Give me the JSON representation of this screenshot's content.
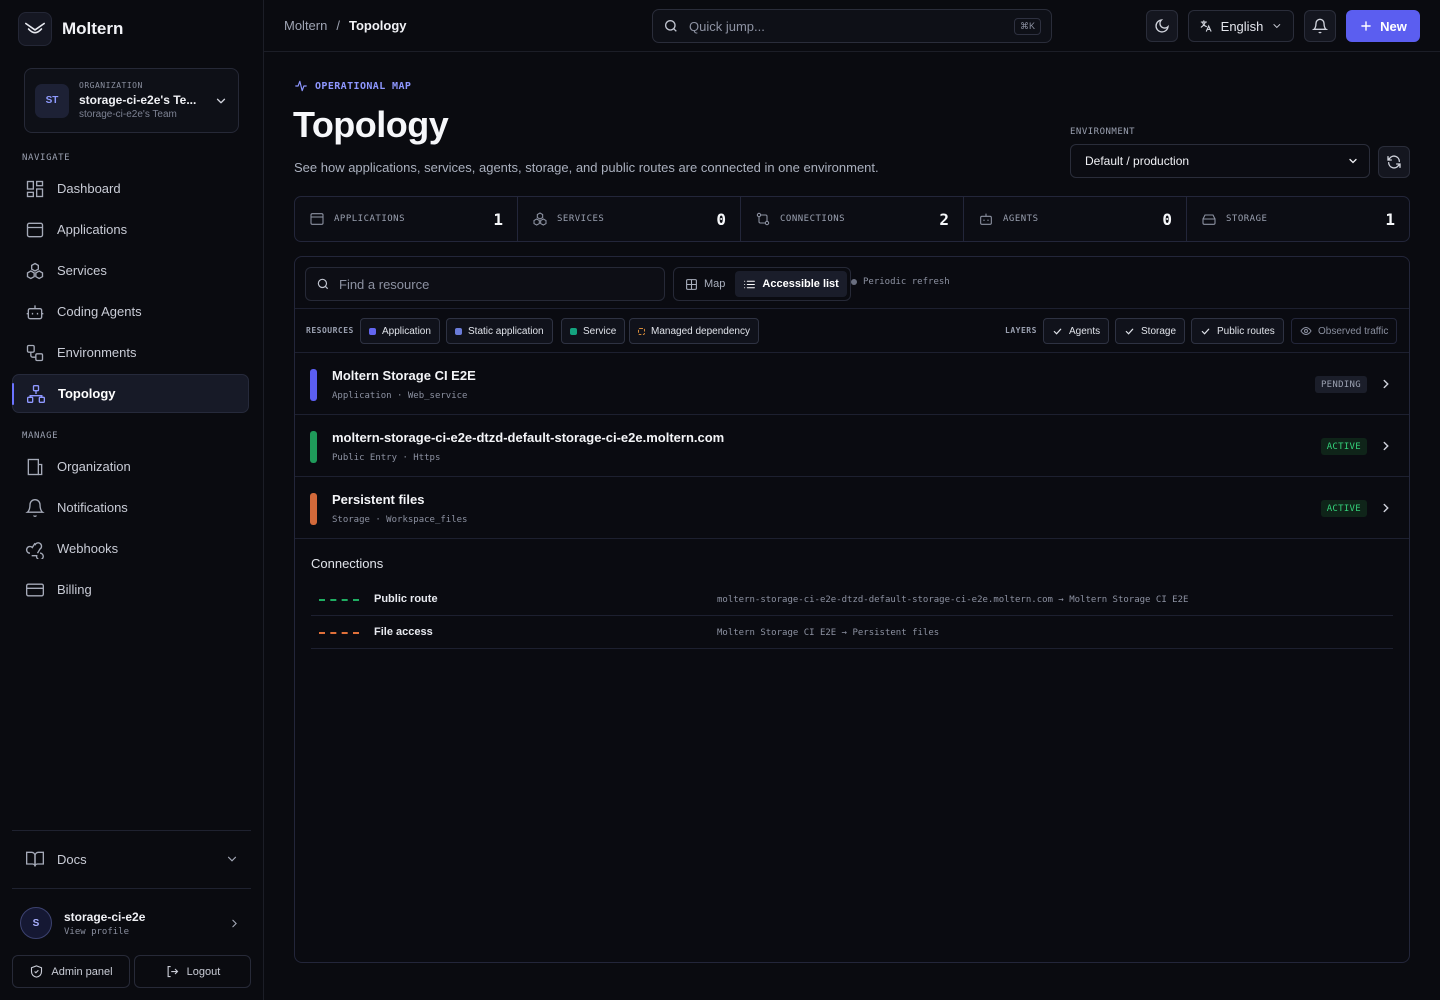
{
  "brand": {
    "name": "Moltern"
  },
  "org": {
    "kicker": "ORGANIZATION",
    "initials": "ST",
    "name": "storage-ci-e2e's Te...",
    "sub": "storage-ci-e2e's Team"
  },
  "sidebar": {
    "navigate_label": "NAVIGATE",
    "navigate": [
      {
        "label": "Dashboard"
      },
      {
        "label": "Applications"
      },
      {
        "label": "Services"
      },
      {
        "label": "Coding Agents"
      },
      {
        "label": "Environments"
      },
      {
        "label": "Topology"
      }
    ],
    "manage_label": "MANAGE",
    "manage": [
      {
        "label": "Organization"
      },
      {
        "label": "Notifications"
      },
      {
        "label": "Webhooks"
      },
      {
        "label": "Billing"
      }
    ],
    "docs": "Docs",
    "user": {
      "initial": "S",
      "name": "storage-ci-e2e",
      "sub": "View profile"
    },
    "admin": "Admin panel",
    "logout": "Logout"
  },
  "topbar": {
    "crumb_root": "Moltern",
    "crumb_sep": "/",
    "crumb_current": "Topology",
    "search_placeholder": "Quick jump...",
    "search_kbd": "⌘K",
    "language": "English",
    "new_label": "New"
  },
  "page": {
    "kicker": "OPERATIONAL MAP",
    "title": "Topology",
    "description": "See how applications, services, agents, storage, and public routes are connected in one environment.",
    "env_label": "ENVIRONMENT",
    "env_value": "Default / production"
  },
  "stats": [
    {
      "label": "APPLICATIONS",
      "value": "1"
    },
    {
      "label": "SERVICES",
      "value": "0"
    },
    {
      "label": "CONNECTIONS",
      "value": "2"
    },
    {
      "label": "AGENTS",
      "value": "0"
    },
    {
      "label": "STORAGE",
      "value": "1"
    }
  ],
  "toolbar": {
    "find_placeholder": "Find a resource",
    "view_map": "Map",
    "view_list": "Accessible list",
    "refresh_note": "Periodic refresh"
  },
  "filters": {
    "resources_label": "RESOURCES",
    "resources": [
      {
        "label": "Application",
        "color": "#6366f1"
      },
      {
        "label": "Static application",
        "color": "#6a7bd8"
      },
      {
        "label": "Service",
        "color": "#14a37f"
      },
      {
        "label": "Managed dependency",
        "color": "#d58a3a"
      }
    ],
    "layers_label": "LAYERS",
    "layers": [
      {
        "label": "Agents"
      },
      {
        "label": "Storage"
      },
      {
        "label": "Public routes"
      },
      {
        "label": "Observed traffic"
      }
    ]
  },
  "resources": [
    {
      "title": "Moltern Storage CI E2E",
      "meta": "Application · Web_service",
      "status": "PENDING",
      "color": "#5b5ef0"
    },
    {
      "title": "moltern-storage-ci-e2e-dtzd-default-storage-ci-e2e.moltern.com",
      "meta": "Public Entry · Https",
      "status": "ACTIVE",
      "color": "#1f9a5a"
    },
    {
      "title": "Persistent files",
      "meta": "Storage · Workspace_files",
      "status": "ACTIVE",
      "color": "#d2693a"
    }
  ],
  "connections": {
    "title": "Connections",
    "items": [
      {
        "name": "Public route",
        "desc": "moltern-storage-ci-e2e-dtzd-default-storage-ci-e2e.moltern.com → Moltern Storage CI E2E",
        "color": "#1fae62"
      },
      {
        "name": "File access",
        "desc": "Moltern Storage CI E2E → Persistent files",
        "color": "#e0703a"
      }
    ]
  }
}
